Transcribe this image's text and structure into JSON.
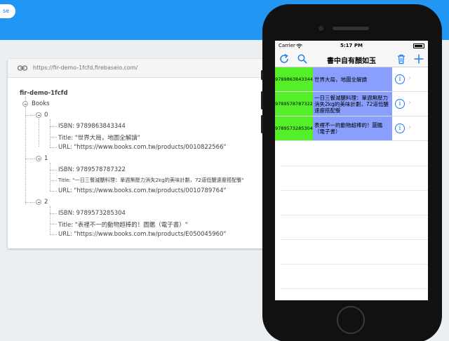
{
  "firebase": {
    "dropdown_text": "se",
    "url": "https://fir-demo-1fcfd.firebaseio.com/",
    "root": "fir-demo-1fcfd",
    "books_key": "Books",
    "records": [
      {
        "index": "0",
        "isbn": "ISBN: 9789863843344",
        "title": "Title: \"世界大局，地圖全解讀\"",
        "url": "URL: \"https://www.books.com.tw/products/0010822566\""
      },
      {
        "index": "1",
        "isbn": "ISBN: 9789578787322",
        "title": "Title: \"一日三餐減醣料理：單週無壓力消失2kg的美味計劃，72道低醣速瘦搭配餐\"",
        "url": "URL: \"https://www.books.com.tw/products/0010789764\""
      },
      {
        "index": "2",
        "isbn": "ISBN: 9789573285304",
        "title": "Title: \"表裡不一的動物超棒的！圖鑑（電子書）\"",
        "url": "URL: \"https://www.books.com.tw/products/E050045960\""
      }
    ]
  },
  "phone": {
    "status": {
      "carrier": "Carrier",
      "time": "5:17 PM"
    },
    "nav_title": "書中自有顏如玉",
    "rows": [
      {
        "isbn": "9789863843344",
        "title": "世界大局，地圖全解讀"
      },
      {
        "isbn": "9789578787322",
        "title": "一日三餐減醣料理：單週無壓力消失2kg的美味計劃，72道低醣速瘦搭配餐"
      },
      {
        "isbn": "9789573285304",
        "title": "表裡不一的動物超棒的！圖鑑（電子書）"
      }
    ],
    "info_glyph": "i",
    "chevron_glyph": "›"
  },
  "colors": {
    "firebase_blue": "#2196f3",
    "isbn_cell": "#55ef2a",
    "title_cell": "#8a9ffd",
    "ios_tint": "#1a7cf5"
  }
}
